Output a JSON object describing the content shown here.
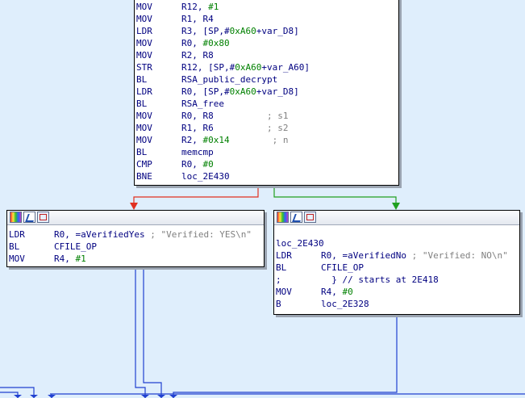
{
  "top_block": {
    "lines": [
      {
        "mn": "MOV",
        "op": "R12, ",
        "num": "#1"
      },
      {
        "mn": "MOV",
        "op": "R1, R4"
      },
      {
        "mn": "LDR",
        "op": "R3, [SP,#",
        "num": "0xA60",
        "op2": "+var_D8]"
      },
      {
        "mn": "MOV",
        "op": "R0, ",
        "num": "#0x80"
      },
      {
        "mn": "MOV",
        "op": "R2, R8"
      },
      {
        "mn": "STR",
        "op": "R12, [SP,#",
        "num": "0xA60",
        "op2": "+var_A60]"
      },
      {
        "mn": "BL",
        "op": "RSA_public_decrypt"
      },
      {
        "mn": "LDR",
        "op": "R0, [SP,#",
        "num": "0xA60",
        "op2": "+var_D8]"
      },
      {
        "mn": "BL",
        "op": "RSA_free"
      },
      {
        "mn": "MOV",
        "op": "R0, R8          ",
        "cmt": "; s1"
      },
      {
        "mn": "MOV",
        "op": "R1, R6          ",
        "cmt": "; s2"
      },
      {
        "mn": "MOV",
        "op": "R2, ",
        "num": "#0x14",
        "op2": "        ",
        "cmt": "; n"
      },
      {
        "mn": "BL",
        "op": "memcmp"
      },
      {
        "mn": "CMP",
        "op": "R0, ",
        "num": "#0"
      },
      {
        "mn": "BNE",
        "op": "loc_2E430"
      }
    ]
  },
  "left_block": {
    "lines": [
      {
        "mn": "LDR",
        "op": "R0, =aVerifiedYes ",
        "cmt": "; \"Verified: YES\\n\""
      },
      {
        "mn": "BL",
        "op": "CFILE_OP"
      },
      {
        "mn": "MOV",
        "op": "R4, ",
        "num": "#1"
      }
    ]
  },
  "right_block": {
    "label": "loc_2E430",
    "lines": [
      {
        "mn": "LDR",
        "op": "R0, =aVerifiedNo ",
        "cmt": "; \"Verified: NO\\n\""
      },
      {
        "mn": "BL",
        "op": "CFILE_OP"
      },
      {
        "mn": ";",
        "op": "  } // starts at 2E418"
      },
      {
        "mn": "MOV",
        "op": "R4, ",
        "num": "#0"
      },
      {
        "mn": "B",
        "op": "loc_2E328"
      }
    ]
  },
  "colors": {
    "false_edge": "#e03020",
    "true_edge": "#20a020",
    "normal_edge": "#2040d0",
    "background": "#dfeefc"
  },
  "icons": [
    "color-palette-icon",
    "rename-pen-icon",
    "graph-view-icon"
  ]
}
